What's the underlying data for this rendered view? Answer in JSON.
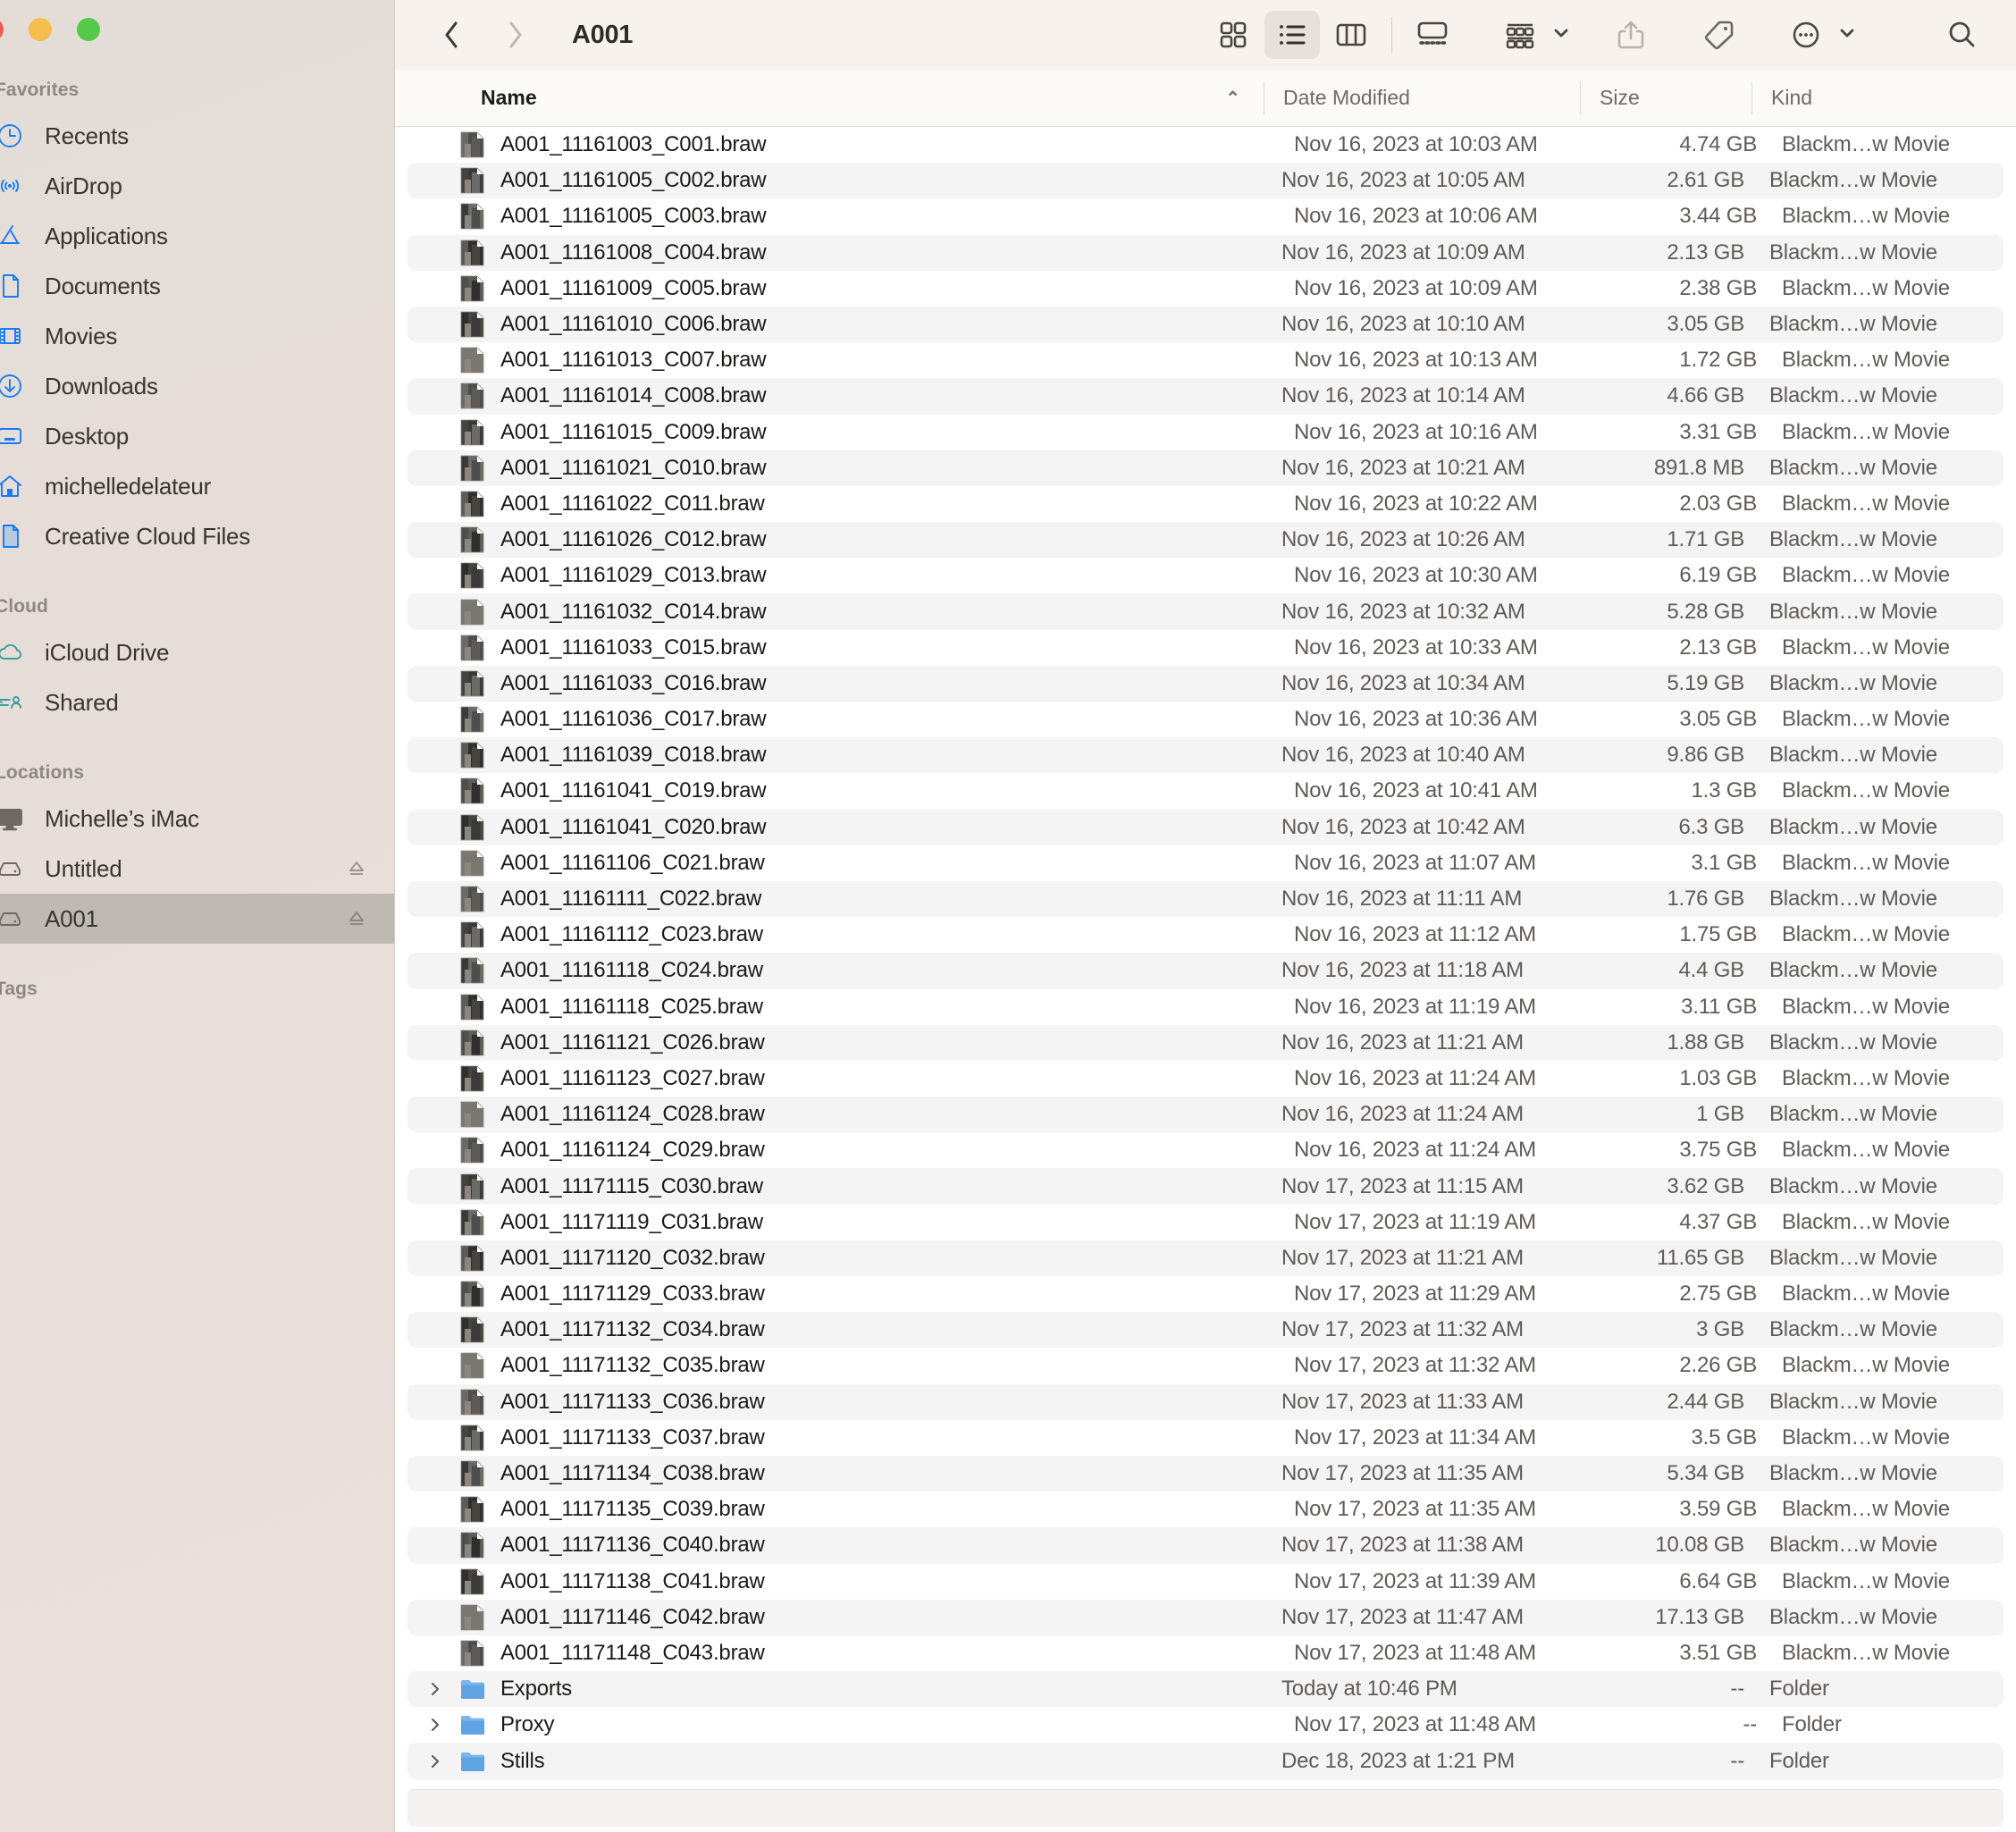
{
  "window": {
    "title": "A001",
    "traffic_lights": [
      "close-button",
      "minimize-button",
      "zoom-button"
    ]
  },
  "toolbar": {
    "back_label": "Back",
    "forward_label": "Forward",
    "view_icon": "icon-view-button",
    "view_list": "list-view-button",
    "view_column": "column-view-button",
    "view_gallery": "gallery-view-button",
    "group_by": "group-by-button",
    "share": "share-button",
    "tag": "tag-button",
    "more": "more-actions-button",
    "search": "search-button"
  },
  "sidebar": {
    "sections": [
      {
        "title": "Favorites",
        "items": [
          {
            "label": "Recents",
            "icon": "clock-icon",
            "selected": false,
            "eject": false
          },
          {
            "label": "AirDrop",
            "icon": "airdrop-icon",
            "selected": false,
            "eject": false
          },
          {
            "label": "Applications",
            "icon": "applications-icon",
            "selected": false,
            "eject": false
          },
          {
            "label": "Documents",
            "icon": "document-icon",
            "selected": false,
            "eject": false
          },
          {
            "label": "Movies",
            "icon": "film-icon",
            "selected": false,
            "eject": false
          },
          {
            "label": "Downloads",
            "icon": "download-icon",
            "selected": false,
            "eject": false
          },
          {
            "label": "Desktop",
            "icon": "desktop-icon",
            "selected": false,
            "eject": false
          },
          {
            "label": "michelledelateur",
            "icon": "home-icon",
            "selected": false,
            "eject": false
          },
          {
            "label": "Creative Cloud Files",
            "icon": "creative-cloud-icon",
            "selected": false,
            "eject": false
          }
        ]
      },
      {
        "title": "Cloud",
        "items": [
          {
            "label": "iCloud Drive",
            "icon": "cloud-icon",
            "selected": false,
            "eject": false
          },
          {
            "label": "Shared",
            "icon": "shared-folder-icon",
            "selected": false,
            "eject": false
          }
        ]
      },
      {
        "title": "Locations",
        "items": [
          {
            "label": "Michelle’s iMac",
            "icon": "imac-icon",
            "selected": false,
            "eject": false
          },
          {
            "label": "Untitled",
            "icon": "external-drive-icon",
            "selected": false,
            "eject": true
          },
          {
            "label": "A001",
            "icon": "external-drive-icon",
            "selected": true,
            "eject": true
          }
        ]
      },
      {
        "title": "Tags",
        "items": []
      }
    ]
  },
  "columns": {
    "name": "Name",
    "date_modified": "Date Modified",
    "size": "Size",
    "kind": "Kind",
    "sort_indicator": "⌃",
    "sort_column": "Name",
    "sort_direction": "ascending"
  },
  "files": [
    {
      "name": "A001_11161003_C001.braw",
      "date": "Nov 16, 2023 at 10:03 AM",
      "size": "4.74 GB",
      "kind": "Blackm…w Movie",
      "type": "file"
    },
    {
      "name": "A001_11161005_C002.braw",
      "date": "Nov 16, 2023 at 10:05 AM",
      "size": "2.61 GB",
      "kind": "Blackm…w Movie",
      "type": "file"
    },
    {
      "name": "A001_11161005_C003.braw",
      "date": "Nov 16, 2023 at 10:06 AM",
      "size": "3.44 GB",
      "kind": "Blackm…w Movie",
      "type": "file"
    },
    {
      "name": "A001_11161008_C004.braw",
      "date": "Nov 16, 2023 at 10:09 AM",
      "size": "2.13 GB",
      "kind": "Blackm…w Movie",
      "type": "file"
    },
    {
      "name": "A001_11161009_C005.braw",
      "date": "Nov 16, 2023 at 10:09 AM",
      "size": "2.38 GB",
      "kind": "Blackm…w Movie",
      "type": "file"
    },
    {
      "name": "A001_11161010_C006.braw",
      "date": "Nov 16, 2023 at 10:10 AM",
      "size": "3.05 GB",
      "kind": "Blackm…w Movie",
      "type": "file"
    },
    {
      "name": "A001_11161013_C007.braw",
      "date": "Nov 16, 2023 at 10:13 AM",
      "size": "1.72 GB",
      "kind": "Blackm…w Movie",
      "type": "file"
    },
    {
      "name": "A001_11161014_C008.braw",
      "date": "Nov 16, 2023 at 10:14 AM",
      "size": "4.66 GB",
      "kind": "Blackm…w Movie",
      "type": "file"
    },
    {
      "name": "A001_11161015_C009.braw",
      "date": "Nov 16, 2023 at 10:16 AM",
      "size": "3.31 GB",
      "kind": "Blackm…w Movie",
      "type": "file"
    },
    {
      "name": "A001_11161021_C010.braw",
      "date": "Nov 16, 2023 at 10:21 AM",
      "size": "891.8 MB",
      "kind": "Blackm…w Movie",
      "type": "file"
    },
    {
      "name": "A001_11161022_C011.braw",
      "date": "Nov 16, 2023 at 10:22 AM",
      "size": "2.03 GB",
      "kind": "Blackm…w Movie",
      "type": "file"
    },
    {
      "name": "A001_11161026_C012.braw",
      "date": "Nov 16, 2023 at 10:26 AM",
      "size": "1.71 GB",
      "kind": "Blackm…w Movie",
      "type": "file"
    },
    {
      "name": "A001_11161029_C013.braw",
      "date": "Nov 16, 2023 at 10:30 AM",
      "size": "6.19 GB",
      "kind": "Blackm…w Movie",
      "type": "file"
    },
    {
      "name": "A001_11161032_C014.braw",
      "date": "Nov 16, 2023 at 10:32 AM",
      "size": "5.28 GB",
      "kind": "Blackm…w Movie",
      "type": "file"
    },
    {
      "name": "A001_11161033_C015.braw",
      "date": "Nov 16, 2023 at 10:33 AM",
      "size": "2.13 GB",
      "kind": "Blackm…w Movie",
      "type": "file"
    },
    {
      "name": "A001_11161033_C016.braw",
      "date": "Nov 16, 2023 at 10:34 AM",
      "size": "5.19 GB",
      "kind": "Blackm…w Movie",
      "type": "file"
    },
    {
      "name": "A001_11161036_C017.braw",
      "date": "Nov 16, 2023 at 10:36 AM",
      "size": "3.05 GB",
      "kind": "Blackm…w Movie",
      "type": "file"
    },
    {
      "name": "A001_11161039_C018.braw",
      "date": "Nov 16, 2023 at 10:40 AM",
      "size": "9.86 GB",
      "kind": "Blackm…w Movie",
      "type": "file"
    },
    {
      "name": "A001_11161041_C019.braw",
      "date": "Nov 16, 2023 at 10:41 AM",
      "size": "1.3 GB",
      "kind": "Blackm…w Movie",
      "type": "file"
    },
    {
      "name": "A001_11161041_C020.braw",
      "date": "Nov 16, 2023 at 10:42 AM",
      "size": "6.3 GB",
      "kind": "Blackm…w Movie",
      "type": "file"
    },
    {
      "name": "A001_11161106_C021.braw",
      "date": "Nov 16, 2023 at 11:07 AM",
      "size": "3.1 GB",
      "kind": "Blackm…w Movie",
      "type": "file"
    },
    {
      "name": "A001_11161111_C022.braw",
      "date": "Nov 16, 2023 at 11:11 AM",
      "size": "1.76 GB",
      "kind": "Blackm…w Movie",
      "type": "file"
    },
    {
      "name": "A001_11161112_C023.braw",
      "date": "Nov 16, 2023 at 11:12 AM",
      "size": "1.75 GB",
      "kind": "Blackm…w Movie",
      "type": "file"
    },
    {
      "name": "A001_11161118_C024.braw",
      "date": "Nov 16, 2023 at 11:18 AM",
      "size": "4.4 GB",
      "kind": "Blackm…w Movie",
      "type": "file"
    },
    {
      "name": "A001_11161118_C025.braw",
      "date": "Nov 16, 2023 at 11:19 AM",
      "size": "3.11 GB",
      "kind": "Blackm…w Movie",
      "type": "file"
    },
    {
      "name": "A001_11161121_C026.braw",
      "date": "Nov 16, 2023 at 11:21 AM",
      "size": "1.88 GB",
      "kind": "Blackm…w Movie",
      "type": "file"
    },
    {
      "name": "A001_11161123_C027.braw",
      "date": "Nov 16, 2023 at 11:24 AM",
      "size": "1.03 GB",
      "kind": "Blackm…w Movie",
      "type": "file"
    },
    {
      "name": "A001_11161124_C028.braw",
      "date": "Nov 16, 2023 at 11:24 AM",
      "size": "1 GB",
      "kind": "Blackm…w Movie",
      "type": "file"
    },
    {
      "name": "A001_11161124_C029.braw",
      "date": "Nov 16, 2023 at 11:24 AM",
      "size": "3.75 GB",
      "kind": "Blackm…w Movie",
      "type": "file"
    },
    {
      "name": "A001_11171115_C030.braw",
      "date": "Nov 17, 2023 at 11:15 AM",
      "size": "3.62 GB",
      "kind": "Blackm…w Movie",
      "type": "file"
    },
    {
      "name": "A001_11171119_C031.braw",
      "date": "Nov 17, 2023 at 11:19 AM",
      "size": "4.37 GB",
      "kind": "Blackm…w Movie",
      "type": "file"
    },
    {
      "name": "A001_11171120_C032.braw",
      "date": "Nov 17, 2023 at 11:21 AM",
      "size": "11.65 GB",
      "kind": "Blackm…w Movie",
      "type": "file"
    },
    {
      "name": "A001_11171129_C033.braw",
      "date": "Nov 17, 2023 at 11:29 AM",
      "size": "2.75 GB",
      "kind": "Blackm…w Movie",
      "type": "file"
    },
    {
      "name": "A001_11171132_C034.braw",
      "date": "Nov 17, 2023 at 11:32 AM",
      "size": "3 GB",
      "kind": "Blackm…w Movie",
      "type": "file"
    },
    {
      "name": "A001_11171132_C035.braw",
      "date": "Nov 17, 2023 at 11:32 AM",
      "size": "2.26 GB",
      "kind": "Blackm…w Movie",
      "type": "file"
    },
    {
      "name": "A001_11171133_C036.braw",
      "date": "Nov 17, 2023 at 11:33 AM",
      "size": "2.44 GB",
      "kind": "Blackm…w Movie",
      "type": "file"
    },
    {
      "name": "A001_11171133_C037.braw",
      "date": "Nov 17, 2023 at 11:34 AM",
      "size": "3.5 GB",
      "kind": "Blackm…w Movie",
      "type": "file"
    },
    {
      "name": "A001_11171134_C038.braw",
      "date": "Nov 17, 2023 at 11:35 AM",
      "size": "5.34 GB",
      "kind": "Blackm…w Movie",
      "type": "file"
    },
    {
      "name": "A001_11171135_C039.braw",
      "date": "Nov 17, 2023 at 11:35 AM",
      "size": "3.59 GB",
      "kind": "Blackm…w Movie",
      "type": "file"
    },
    {
      "name": "A001_11171136_C040.braw",
      "date": "Nov 17, 2023 at 11:38 AM",
      "size": "10.08 GB",
      "kind": "Blackm…w Movie",
      "type": "file"
    },
    {
      "name": "A001_11171138_C041.braw",
      "date": "Nov 17, 2023 at 11:39 AM",
      "size": "6.64 GB",
      "kind": "Blackm…w Movie",
      "type": "file"
    },
    {
      "name": "A001_11171146_C042.braw",
      "date": "Nov 17, 2023 at 11:47 AM",
      "size": "17.13 GB",
      "kind": "Blackm…w Movie",
      "type": "file"
    },
    {
      "name": "A001_11171148_C043.braw",
      "date": "Nov 17, 2023 at 11:48 AM",
      "size": "3.51 GB",
      "kind": "Blackm…w Movie",
      "type": "file"
    },
    {
      "name": "Exports",
      "date": "Today at 10:46 PM",
      "size": "--",
      "kind": "Folder",
      "type": "folder"
    },
    {
      "name": "Proxy",
      "date": "Nov 17, 2023 at 11:48 AM",
      "size": "--",
      "kind": "Folder",
      "type": "folder"
    },
    {
      "name": "Stills",
      "date": "Dec 18, 2023 at 1:21 PM",
      "size": "--",
      "kind": "Folder",
      "type": "folder"
    }
  ],
  "colors": {
    "sidebar_accent": "#1a7af8",
    "icloud_accent": "#3a9e9b",
    "folder_blue": "#63a8e8",
    "selection_gray": "#bfb9b4",
    "row_alt": "#f4f4f4"
  }
}
